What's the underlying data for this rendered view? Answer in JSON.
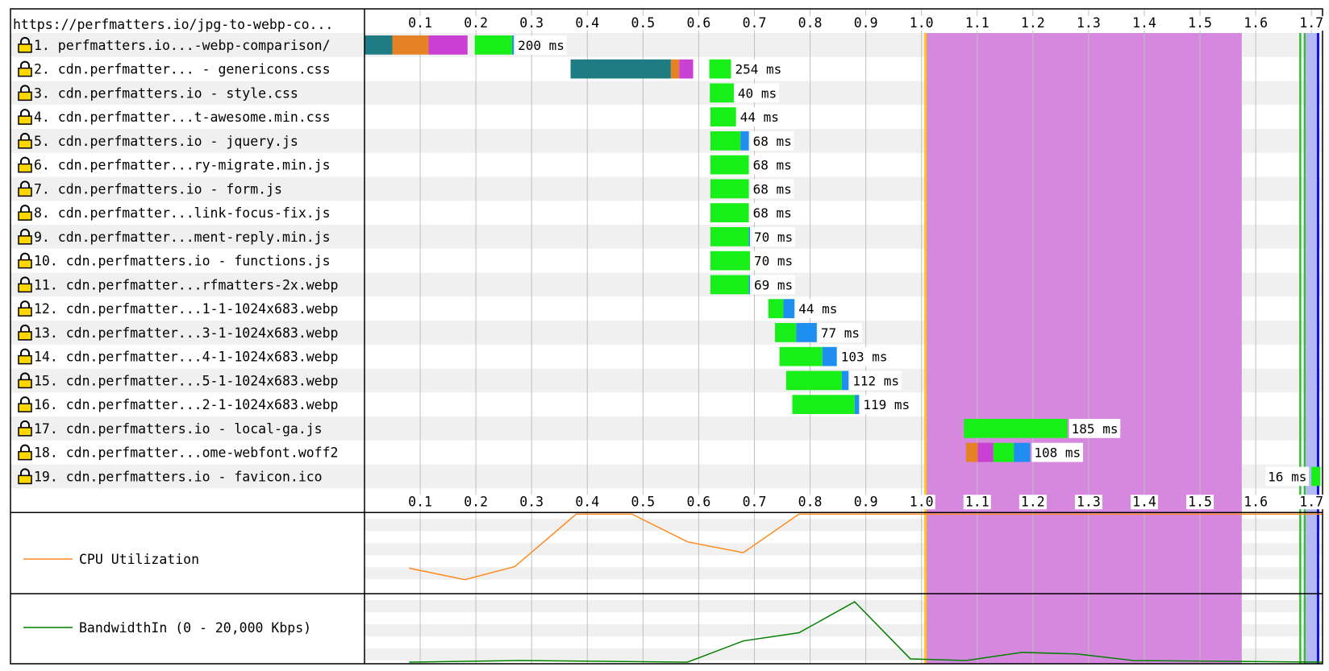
{
  "page_url": "https://perfmatters.io/jpg-to-webp-co...",
  "chart_data": {
    "type": "waterfall",
    "x_unit": "seconds",
    "x_ticks": [
      0.1,
      0.2,
      0.3,
      0.4,
      0.5,
      0.6,
      0.7,
      0.8,
      0.9,
      1.0,
      1.1,
      1.2,
      1.3,
      1.4,
      1.5,
      1.6,
      1.7
    ],
    "x_range": [
      0.0,
      1.72
    ],
    "colors": {
      "dns": "#1f7c83",
      "connect": "#e58226",
      "ssl": "#c940d3",
      "ttfb": "#18ef18",
      "download": "#1e8ff0",
      "cpu": "#ff8a1f",
      "bandwidth": "#008000",
      "long_task": "#d688de",
      "start_render": "#3ab83a",
      "dom_interactive": "#ffc61a",
      "dom_content_loaded": "#b3b9f2",
      "on_load": "#1010ee"
    },
    "requests": [
      {
        "label": " 1. perfmatters.io...-webp-comparison/",
        "dns": [
          0.0,
          0.05
        ],
        "connect": [
          0.05,
          0.115
        ],
        "ssl": [
          0.115,
          0.185
        ],
        "start": 0.198,
        "ttfb_end": 0.265,
        "end": 0.268,
        "time_label": "200 ms"
      },
      {
        "label": " 2. cdn.perfmatter... - genericons.css",
        "dns": [
          0.37,
          0.55
        ],
        "connect": [
          0.55,
          0.565
        ],
        "ssl": [
          0.565,
          0.59
        ],
        "start": 0.619,
        "ttfb_end": 0.658,
        "end": 0.658,
        "time_label": "254 ms"
      },
      {
        "label": " 3. cdn.perfmatters.io - style.css",
        "start": 0.62,
        "ttfb_end": 0.663,
        "end": 0.663,
        "time_label": "40 ms"
      },
      {
        "label": " 4. cdn.perfmatter...t-awesome.min.css",
        "start": 0.621,
        "ttfb_end": 0.667,
        "end": 0.667,
        "time_label": "44 ms"
      },
      {
        "label": " 5. cdn.perfmatters.io - jquery.js",
        "start": 0.621,
        "ttfb_end": 0.675,
        "end": 0.69,
        "time_label": "68 ms"
      },
      {
        "label": " 6. cdn.perfmatter...ry-migrate.min.js",
        "start": 0.621,
        "ttfb_end": 0.69,
        "end": 0.69,
        "time_label": "68 ms"
      },
      {
        "label": " 7. cdn.perfmatters.io - form.js",
        "start": 0.621,
        "ttfb_end": 0.69,
        "end": 0.69,
        "time_label": "68 ms"
      },
      {
        "label": " 8. cdn.perfmatter...link-focus-fix.js",
        "start": 0.621,
        "ttfb_end": 0.69,
        "end": 0.69,
        "time_label": "68 ms"
      },
      {
        "label": " 9. cdn.perfmatter...ment-reply.min.js",
        "start": 0.621,
        "ttfb_end": 0.69,
        "end": 0.692,
        "time_label": "70 ms"
      },
      {
        "label": "10. cdn.perfmatters.io - functions.js",
        "start": 0.621,
        "ttfb_end": 0.692,
        "end": 0.692,
        "time_label": "70 ms"
      },
      {
        "label": "11. cdn.perfmatter...rfmatters-2x.webp",
        "start": 0.621,
        "ttfb_end": 0.69,
        "end": 0.692,
        "time_label": "69 ms"
      },
      {
        "label": "12. cdn.perfmatter...1-1-1024x683.webp",
        "start": 0.725,
        "ttfb_end": 0.752,
        "end": 0.772,
        "time_label": "44 ms"
      },
      {
        "label": "13. cdn.perfmatter...3-1-1024x683.webp",
        "start": 0.737,
        "ttfb_end": 0.775,
        "end": 0.812,
        "time_label": "77 ms"
      },
      {
        "label": "14. cdn.perfmatter...4-1-1024x683.webp",
        "start": 0.745,
        "ttfb_end": 0.822,
        "end": 0.848,
        "time_label": "103 ms"
      },
      {
        "label": "15. cdn.perfmatter...5-1-1024x683.webp",
        "start": 0.757,
        "ttfb_end": 0.857,
        "end": 0.869,
        "time_label": "112 ms"
      },
      {
        "label": "16. cdn.perfmatter...2-1-1024x683.webp",
        "start": 0.768,
        "ttfb_end": 0.88,
        "end": 0.888,
        "time_label": "119 ms"
      },
      {
        "label": "17. cdn.perfmatters.io - local-ga.js",
        "start": 1.076,
        "ttfb_end": 1.262,
        "end": 1.262,
        "time_label": "185 ms"
      },
      {
        "label": "18. cdn.perfmatter...ome-webfont.woff2",
        "dns": [
          1.085,
          1.08
        ],
        "connect": [
          1.08,
          1.101
        ],
        "ssl": [
          1.101,
          1.129
        ],
        "start": 1.129,
        "ttfb_end": 1.166,
        "end": 1.195,
        "time_label": "108 ms"
      },
      {
        "label": "19. cdn.perfmatters.io - favicon.ico",
        "start": 1.7,
        "ttfb_end": 1.716,
        "end": 1.716,
        "time_label": "16 ms",
        "label_side": "left"
      }
    ],
    "events": {
      "long_task": [
        1.009,
        1.575
      ],
      "dom_interactive": 1.007,
      "start_render": [
        1.68,
        1.688
      ],
      "dom_content_loaded": [
        1.69,
        1.71
      ],
      "on_load": 1.712
    },
    "cpu": {
      "label": "CPU Utilization",
      "unit": "percent",
      "points": [
        [
          0.08,
          30
        ],
        [
          0.18,
          15
        ],
        [
          0.27,
          32
        ],
        [
          0.38,
          100
        ],
        [
          0.48,
          100
        ],
        [
          0.58,
          64
        ],
        [
          0.68,
          50
        ],
        [
          0.78,
          100
        ],
        [
          1.72,
          100
        ]
      ]
    },
    "bandwidth": {
      "label": "BandwidthIn (0 - 20,000 Kbps)",
      "max_kbps": 20000,
      "points": [
        [
          0.08,
          0
        ],
        [
          0.28,
          500
        ],
        [
          0.58,
          0
        ],
        [
          0.68,
          6500
        ],
        [
          0.78,
          9000
        ],
        [
          0.88,
          18500
        ],
        [
          0.98,
          1000
        ],
        [
          1.08,
          500
        ],
        [
          1.18,
          3000
        ],
        [
          1.28,
          2500
        ],
        [
          1.38,
          500
        ],
        [
          1.72,
          0
        ]
      ]
    }
  }
}
